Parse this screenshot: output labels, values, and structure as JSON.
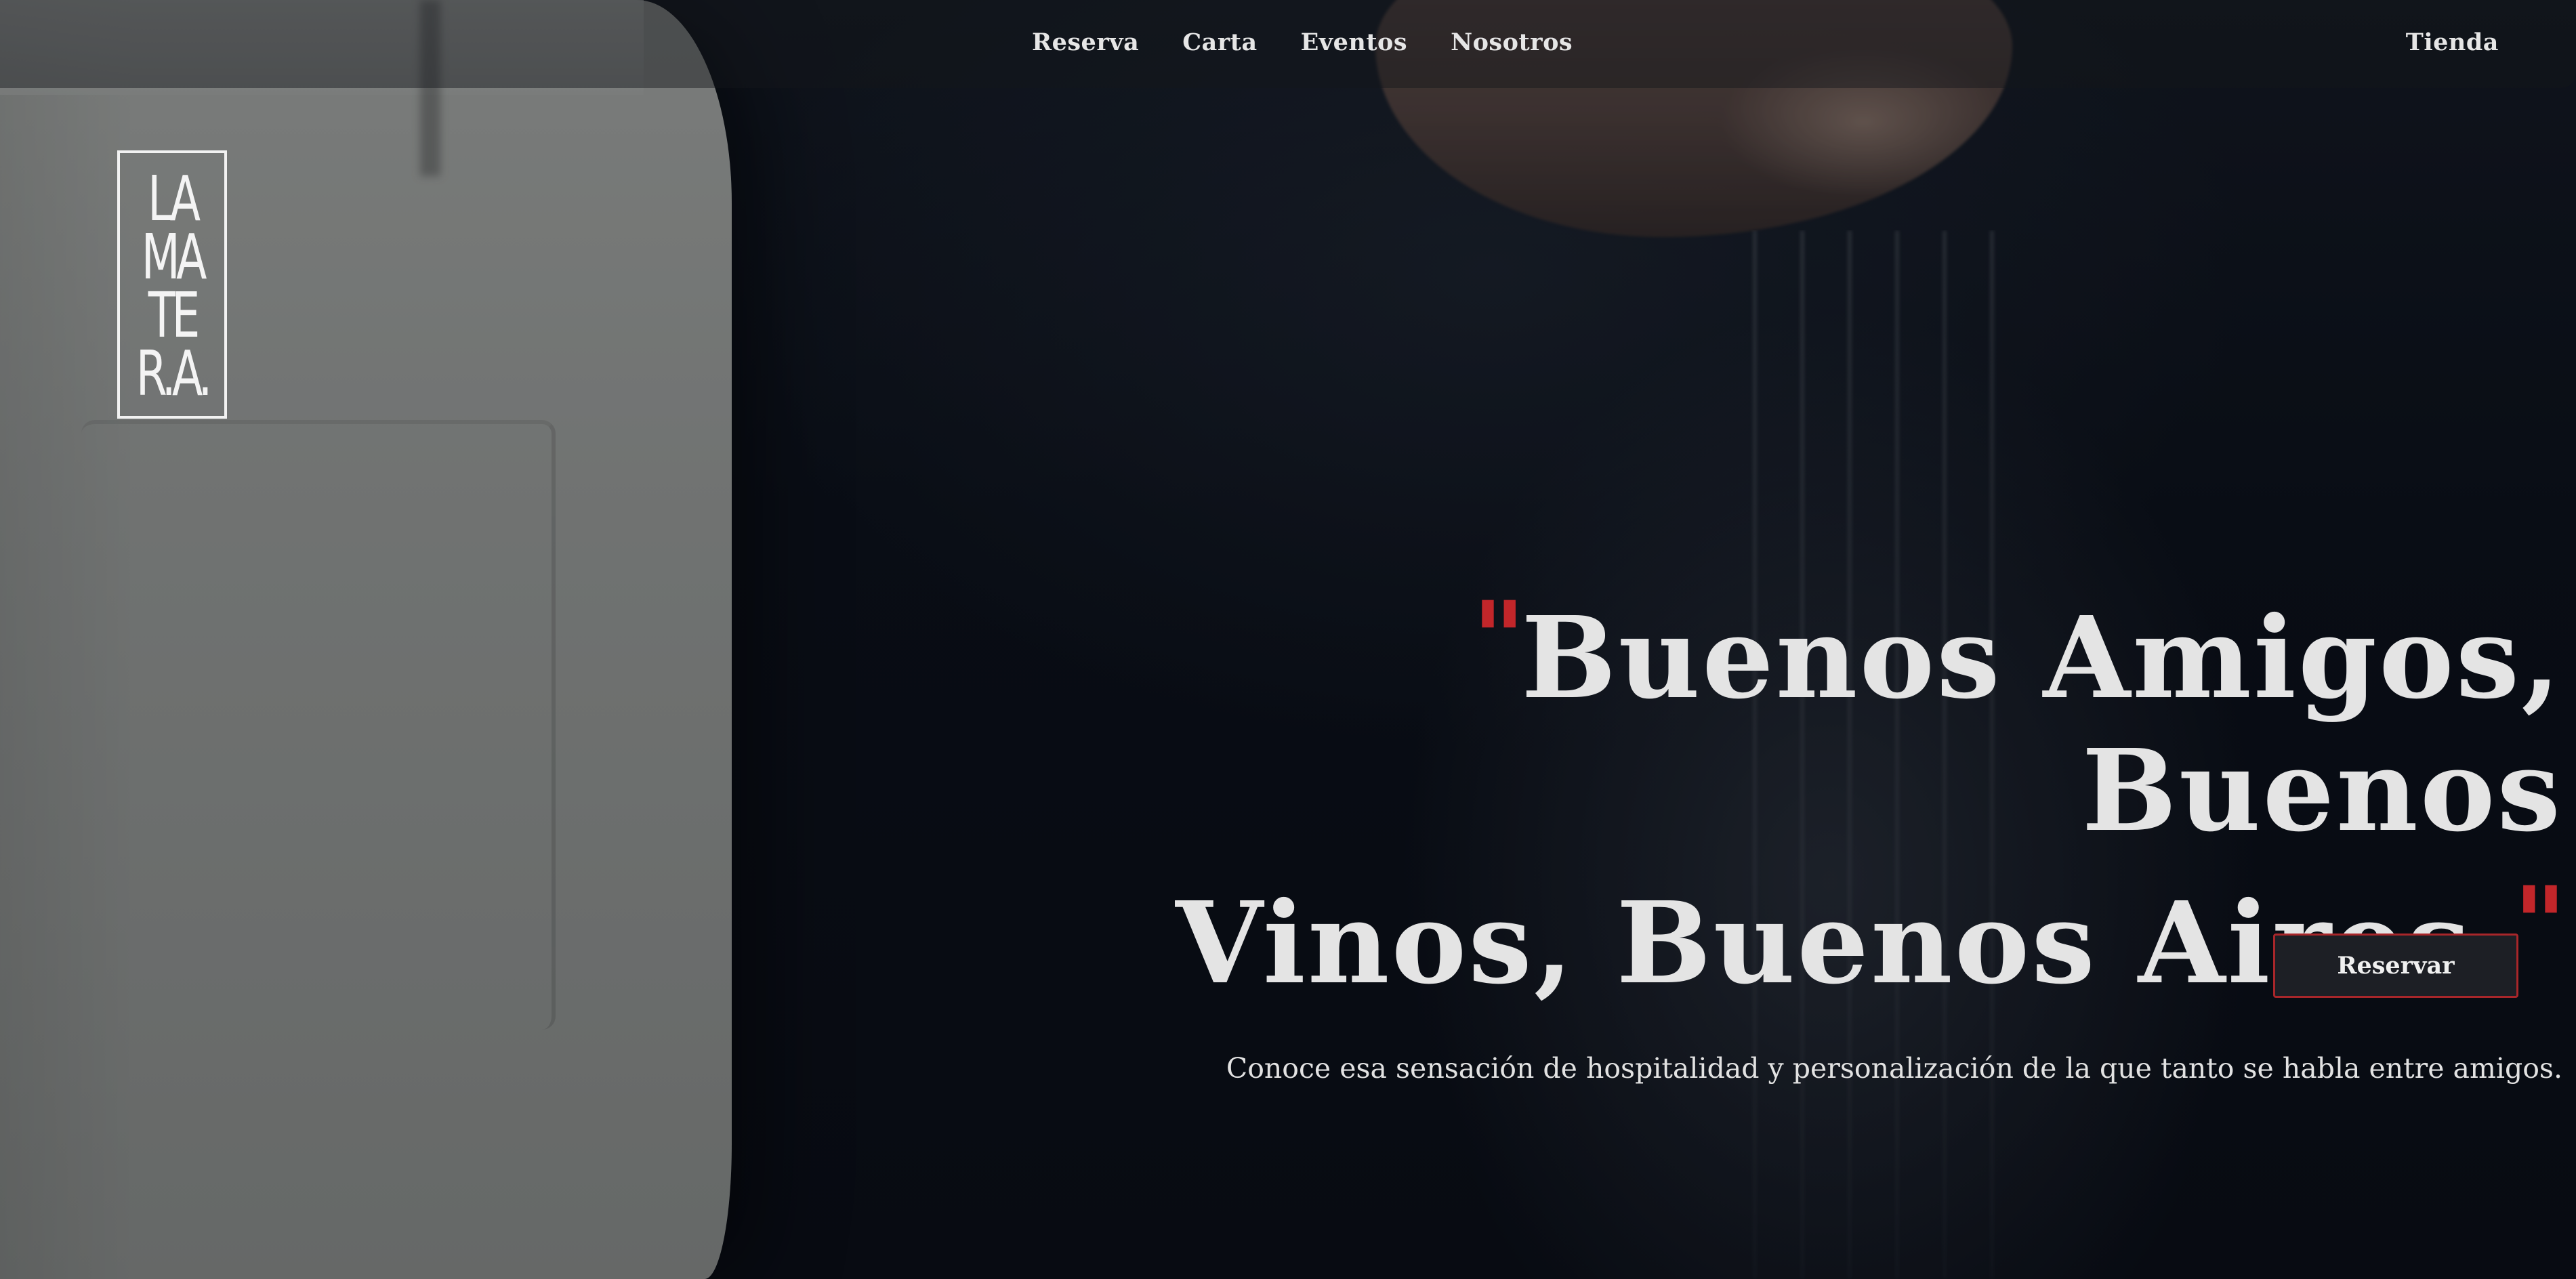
{
  "nav": {
    "items": [
      {
        "label": "Reserva"
      },
      {
        "label": "Carta"
      },
      {
        "label": "Eventos"
      },
      {
        "label": "Nosotros"
      }
    ],
    "shop_label": "Tienda"
  },
  "logo": {
    "lines": [
      "LA",
      "MA",
      "TE",
      "R.A."
    ]
  },
  "hero": {
    "quote_open": "\"",
    "headline_line1": "Buenos Amigos, Buenos",
    "headline_line2": "Vinos, Buenos Aires.",
    "quote_close": "\"",
    "subtitle": "Conoce esa sensación de hospitalidad y personalización de la que tanto se habla entre amigos.",
    "cta_label": "Reservar"
  },
  "colors": {
    "accent": "#c2262a",
    "text": "#e4e4e4",
    "button_bg": "#1d1f25"
  },
  "icons": {
    "logo": "la-matera-logo"
  }
}
